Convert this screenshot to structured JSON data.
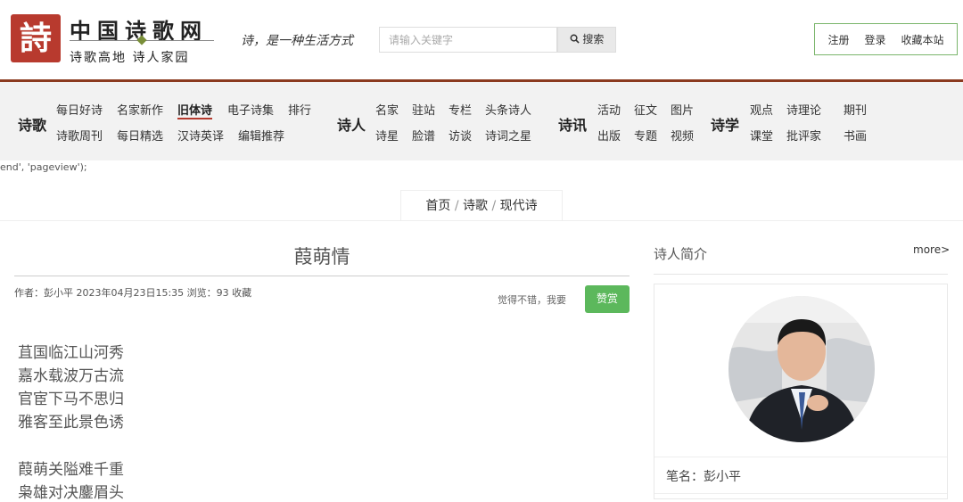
{
  "header": {
    "logo_char": "詩",
    "site_name": "中国诗歌网",
    "site_sub": "诗歌高地 诗人家园",
    "slogan": "诗，是一种生活方式",
    "search": {
      "placeholder": "请输入关键字",
      "button_label": "搜索"
    },
    "user_links": [
      "注册",
      "登录",
      "收藏本站"
    ]
  },
  "nav": {
    "poetry": {
      "label": "诗歌",
      "row1": [
        "每日好诗",
        "名家新作",
        "旧体诗",
        "电子诗集",
        "排行"
      ],
      "row2": [
        "诗歌周刊",
        "每日精选",
        "汉诗英译",
        "编辑推荐"
      ]
    },
    "poets": {
      "label": "诗人",
      "row1": [
        "名家",
        "驻站",
        "专栏",
        "头条诗人"
      ],
      "row2": [
        "诗星",
        "脸谱",
        "访谈",
        "诗词之星"
      ]
    },
    "news": {
      "label": "诗讯",
      "row1": [
        "活动",
        "征文",
        "图片"
      ],
      "row2": [
        "出版",
        "专题",
        "视频"
      ]
    },
    "study": {
      "label": "诗学",
      "row1": [
        "观点",
        "诗理论",
        "期刊"
      ],
      "row2": [
        "课堂",
        "批评家",
        "书画"
      ]
    }
  },
  "stray_code": "end', 'pageview');",
  "breadcrumb": [
    "首页",
    "诗歌",
    "现代诗"
  ],
  "article": {
    "title": "葭萌情",
    "meta": "作者：彭小平    2023年04月23日15:35    浏览：93 收藏",
    "tip": "觉得不错，我要",
    "reward_label": "赞赏",
    "stanzas": [
      [
        "苴国临江山河秀",
        "嘉水载波万古流",
        "官宦下马不思归",
        "雅客至此景色诱"
      ],
      [
        "葭萌关隘难千重",
        "枭雄对决鏖眉头"
      ]
    ]
  },
  "sidebar": {
    "title": "诗人简介",
    "more": "more>",
    "pen_name": "笔名：彭小平"
  },
  "colors": {
    "brand_red": "#b83a2e",
    "nav_rule": "#8b3a1f",
    "reward_green": "#5cb85c",
    "user_box_border": "#7ab56b"
  }
}
